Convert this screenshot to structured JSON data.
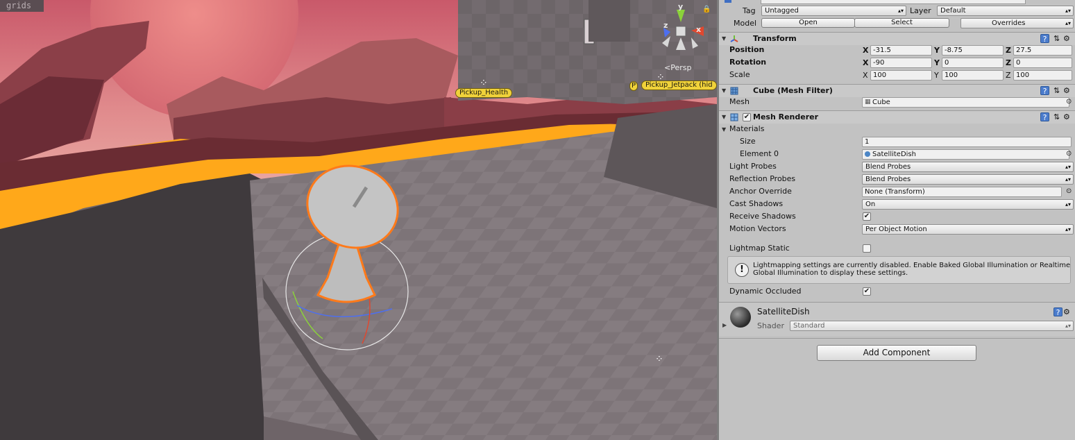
{
  "scene": {
    "grids_label": "grids",
    "persp_label": "Persp",
    "gizmo_axes": {
      "x": "x",
      "y": "y",
      "z": "z"
    },
    "labels": {
      "pickup_health": "Pickup_Health",
      "pickup_p": "P",
      "pickup_jetpack": "Pickup_Jetpack (hid"
    }
  },
  "inspector": {
    "top": {
      "tag_label": "Tag",
      "tag_value": "Untagged",
      "layer_label": "Layer",
      "layer_value": "Default",
      "model_label": "Model",
      "open_label": "Open",
      "select_label": "Select",
      "overrides_label": "Overrides"
    },
    "transform": {
      "title": "Transform",
      "position": {
        "label": "Position",
        "x": "-31.5",
        "y": "-8.75",
        "z": "27.5"
      },
      "rotation": {
        "label": "Rotation",
        "x": "-90",
        "y": "0",
        "z": "0"
      },
      "scale": {
        "label": "Scale",
        "x": "100",
        "y": "100",
        "z": "100"
      },
      "axis_x": "X",
      "axis_y": "Y",
      "axis_z": "Z"
    },
    "mesh_filter": {
      "title": "Cube (Mesh Filter)",
      "mesh_label": "Mesh",
      "mesh_value": "Cube"
    },
    "mesh_renderer": {
      "title": "Mesh Renderer",
      "enabled": true,
      "materials_label": "Materials",
      "size_label": "Size",
      "size_value": "1",
      "element0_label": "Element 0",
      "element0_value": "SatelliteDish",
      "light_probes_label": "Light Probes",
      "light_probes_value": "Blend Probes",
      "reflection_probes_label": "Reflection Probes",
      "reflection_probes_value": "Blend Probes",
      "anchor_override_label": "Anchor Override",
      "anchor_override_value": "None (Transform)",
      "cast_shadows_label": "Cast Shadows",
      "cast_shadows_value": "On",
      "receive_shadows_label": "Receive Shadows",
      "receive_shadows": true,
      "motion_vectors_label": "Motion Vectors",
      "motion_vectors_value": "Per Object Motion",
      "lightmap_static_label": "Lightmap Static",
      "lightmap_static": false,
      "help_text": "Lightmapping settings are currently disabled. Enable Baked Global Illumination or Realtime Global Illumination to display these settings.",
      "dynamic_occluded_label": "Dynamic Occluded",
      "dynamic_occluded": true
    },
    "material": {
      "name": "SatelliteDish",
      "shader_label": "Shader",
      "shader_value": "Standard"
    },
    "add_component_label": "Add Component",
    "check_glyph": "✔",
    "help_glyph": "?",
    "settings_glyph": "⚙",
    "preset_glyph": "⇅",
    "dropdown_arrow": "▴▾",
    "target_glyph": "⊙",
    "warn_glyph": "!",
    "fold_open": "▼",
    "fold_closed": "▶",
    "colors": {
      "selection_outline": "#ff7a1a",
      "label_yellow": "#f0d23a",
      "help_blue": "#4b7ccc",
      "lava": "#ffb21a"
    }
  }
}
